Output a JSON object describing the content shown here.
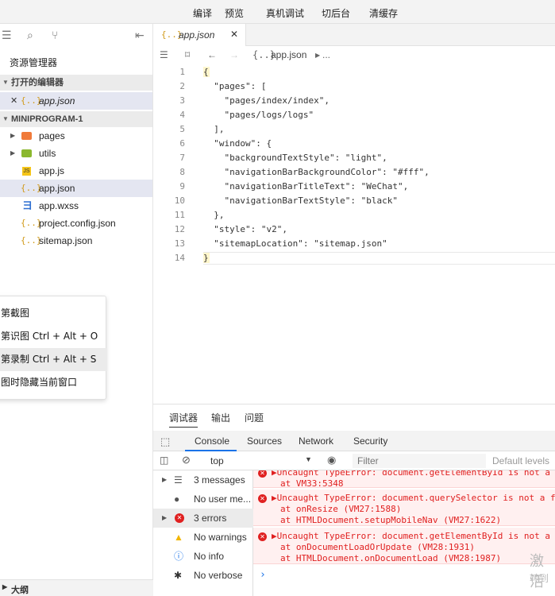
{
  "toolbar": {
    "compile": "编译",
    "preview": "预览",
    "remote_debug": "真机调试",
    "background": "切后台",
    "clear_cache": "清缓存"
  },
  "sidebar": {
    "title": "资源管理器",
    "open_editors": "打开的编辑器",
    "open_file": "app.json",
    "project": "MINIPROGRAM-1",
    "files": [
      {
        "name": "pages",
        "kind": "folder"
      },
      {
        "name": "utils",
        "kind": "folder"
      },
      {
        "name": "app.js",
        "kind": "js"
      },
      {
        "name": "app.json",
        "kind": "json"
      },
      {
        "name": "app.wxss",
        "kind": "wxss"
      },
      {
        "name": "project.config.json",
        "kind": "json"
      },
      {
        "name": "sitemap.json",
        "kind": "json"
      }
    ],
    "outline": "大纲"
  },
  "context_menu": {
    "items": [
      "第截图",
      "第识图 Ctrl + Alt + O",
      "第录制 Ctrl + Alt + S",
      "图时隐藏当前窗口"
    ]
  },
  "editor": {
    "tab": "app.json",
    "breadcrumb_file": "app.json",
    "breadcrumb_more": "...",
    "lines": [
      "{",
      "  \"pages\": [",
      "    \"pages/index/index\",",
      "    \"pages/logs/logs\"",
      "  ],",
      "  \"window\": {",
      "    \"backgroundTextStyle\": \"light\",",
      "    \"navigationBarBackgroundColor\": \"#fff\",",
      "    \"navigationBarTitleText\": \"WeChat\",",
      "    \"navigationBarTextStyle\": \"black\"",
      "  },",
      "  \"style\": \"v2\",",
      "  \"sitemapLocation\": \"sitemap.json\"",
      "}"
    ],
    "line_numbers": [
      "1",
      "2",
      "3",
      "4",
      "5",
      "6",
      "7",
      "8",
      "9",
      "10",
      "11",
      "12",
      "13",
      "14"
    ]
  },
  "panel": {
    "tabs": [
      "调试器",
      "输出",
      "问题"
    ],
    "devtools_tabs": [
      "Console",
      "Sources",
      "Network",
      "Security"
    ],
    "context": "top",
    "filter_placeholder": "Filter",
    "levels": "Default levels",
    "sidebar": [
      {
        "label": "3 messages",
        "icon": "list-icon"
      },
      {
        "label": "No user me...",
        "icon": "user-icon"
      },
      {
        "label": "3 errors",
        "icon": "error-icon"
      },
      {
        "label": "No warnings",
        "icon": "warning-icon"
      },
      {
        "label": "No info",
        "icon": "info-icon"
      },
      {
        "label": "No verbose",
        "icon": "bug-icon"
      }
    ],
    "errors": [
      {
        "msg": "▶Uncaught TypeError: document.getElementById is not a",
        "at": [
          "at VM33:5348"
        ]
      },
      {
        "msg": "▶Uncaught TypeError: document.querySelector is not a f",
        "at": [
          "at onResize (VM27:1588)",
          "at HTMLDocument.setupMobileNav (VM27:1622)"
        ]
      },
      {
        "msg": "▶Uncaught TypeError: document.getElementById is not a",
        "at": [
          "at onDocumentLoadOrUpdate (VM28:1931)",
          "at HTMLDocument.onDocumentLoad (VM28:1987)"
        ]
      }
    ],
    "prompt": "›"
  },
  "watermark": {
    "line1": "激活",
    "line2": "转到"
  }
}
